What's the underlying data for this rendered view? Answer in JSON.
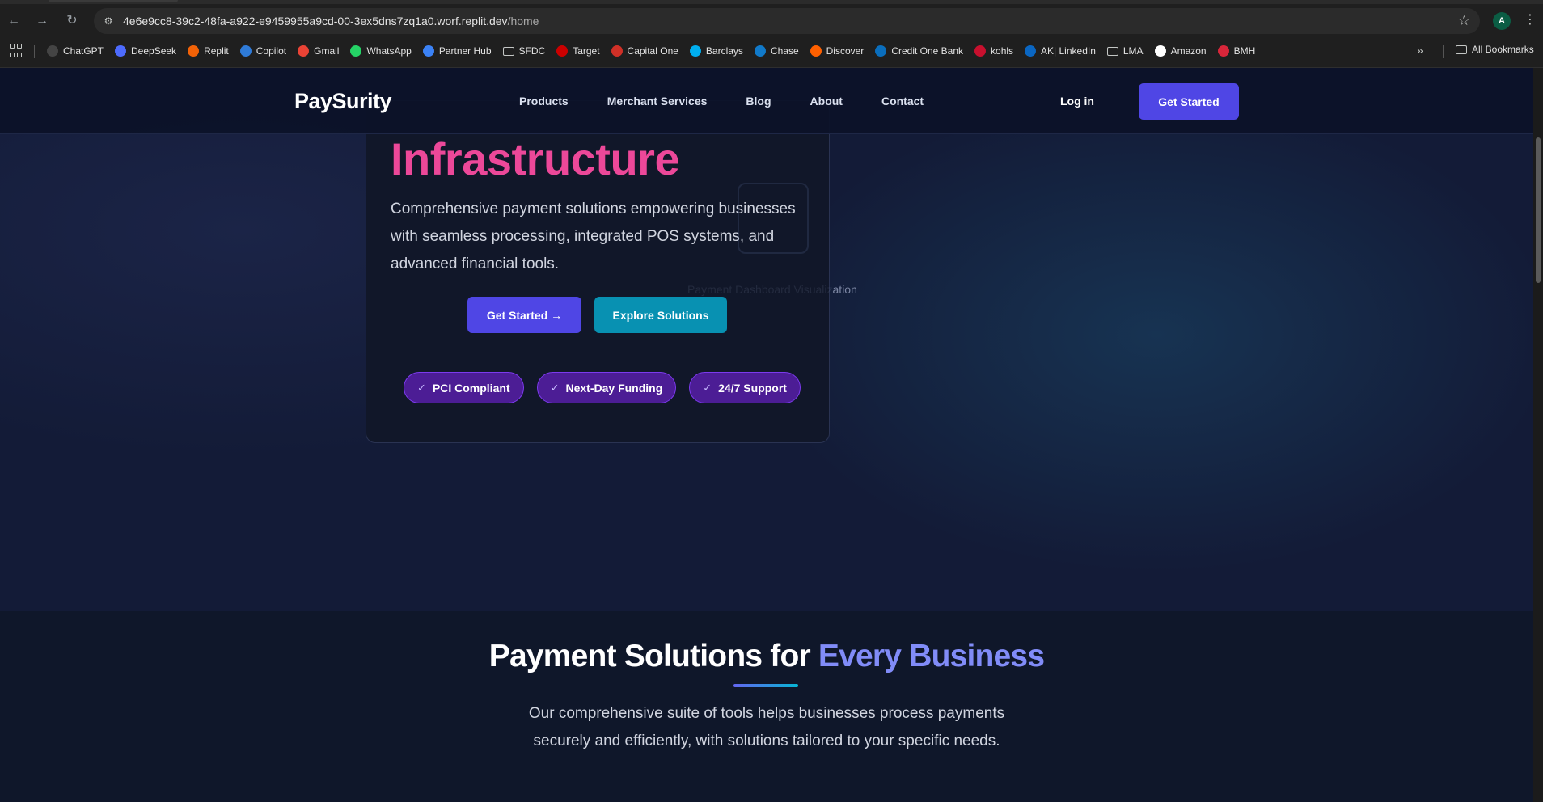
{
  "browser": {
    "url_host": "4e6e9cc8-39c2-48fa-a922-e9459955a9cd-00-3ex5dns7zq1a0.worf.replit.dev",
    "url_path": "/home",
    "profile_initial": "A",
    "bookmarks": [
      {
        "label": "ChatGPT",
        "icon": "chatgpt-icon",
        "color": "#444444"
      },
      {
        "label": "DeepSeek",
        "icon": "deepseek-icon",
        "color": "#4d6bfe"
      },
      {
        "label": "Replit",
        "icon": "replit-icon",
        "color": "#f26207"
      },
      {
        "label": "Copilot",
        "icon": "copilot-icon",
        "color": "#2f7bd8"
      },
      {
        "label": "Gmail",
        "icon": "gmail-icon",
        "color": "#ea4335"
      },
      {
        "label": "WhatsApp",
        "icon": "whatsapp-icon",
        "color": "#25d366"
      },
      {
        "label": "Partner Hub",
        "icon": "partner-hub-icon",
        "color": "#3b82f6"
      },
      {
        "label": "SFDC",
        "icon": "folder-icon",
        "color": ""
      },
      {
        "label": "Target",
        "icon": "target-icon",
        "color": "#cc0000"
      },
      {
        "label": "Capital One",
        "icon": "capital-one-icon",
        "color": "#d03027"
      },
      {
        "label": "Barclays",
        "icon": "barclays-icon",
        "color": "#00aeef"
      },
      {
        "label": "Chase",
        "icon": "chase-icon",
        "color": "#117aca"
      },
      {
        "label": "Discover",
        "icon": "discover-icon",
        "color": "#ff6000"
      },
      {
        "label": "Credit One Bank",
        "icon": "credit-one-icon",
        "color": "#0a6ebd"
      },
      {
        "label": "kohls",
        "icon": "kohls-icon",
        "color": "#c8102e"
      },
      {
        "label": "AK| LinkedIn",
        "icon": "linkedin-icon",
        "color": "#0a66c2"
      },
      {
        "label": "LMA",
        "icon": "folder-icon",
        "color": ""
      },
      {
        "label": "Amazon",
        "icon": "amazon-icon",
        "color": "#ffffff"
      },
      {
        "label": "BMH",
        "icon": "bmh-icon",
        "color": "#d9263a"
      }
    ],
    "all_bookmarks_label": "All Bookmarks"
  },
  "header": {
    "logo": "PaySurity",
    "nav": [
      "Products",
      "Merchant Services",
      "Blog",
      "About",
      "Contact"
    ],
    "login_label": "Log in",
    "cta_label": "Get Started"
  },
  "hero": {
    "title": "Infrastructure",
    "subtitle": "Comprehensive payment solutions empowering businesses with seamless processing, integrated POS systems, and advanced financial tools.",
    "image_caption_faint": "Payment Dashboard Visualiz",
    "image_caption_visible": "ation",
    "primary_button": "Get Started →",
    "secondary_button": "Explore Solutions",
    "badges": [
      "PCI Compliant",
      "Next-Day Funding",
      "24/7 Support"
    ],
    "badge_check": "✓"
  },
  "solutions": {
    "title_main": "Payment Solutions for ",
    "title_accent": "Every Business",
    "subtitle": "Our comprehensive suite of tools helps businesses process payments securely and efficiently, with solutions tailored to your specific needs."
  },
  "colors": {
    "accent_indigo": "#4f46e5",
    "accent_pink": "#ec4899",
    "accent_cyan": "#0891b2",
    "badge_purple": "#4c1d95",
    "title_accent": "#818cf8"
  }
}
